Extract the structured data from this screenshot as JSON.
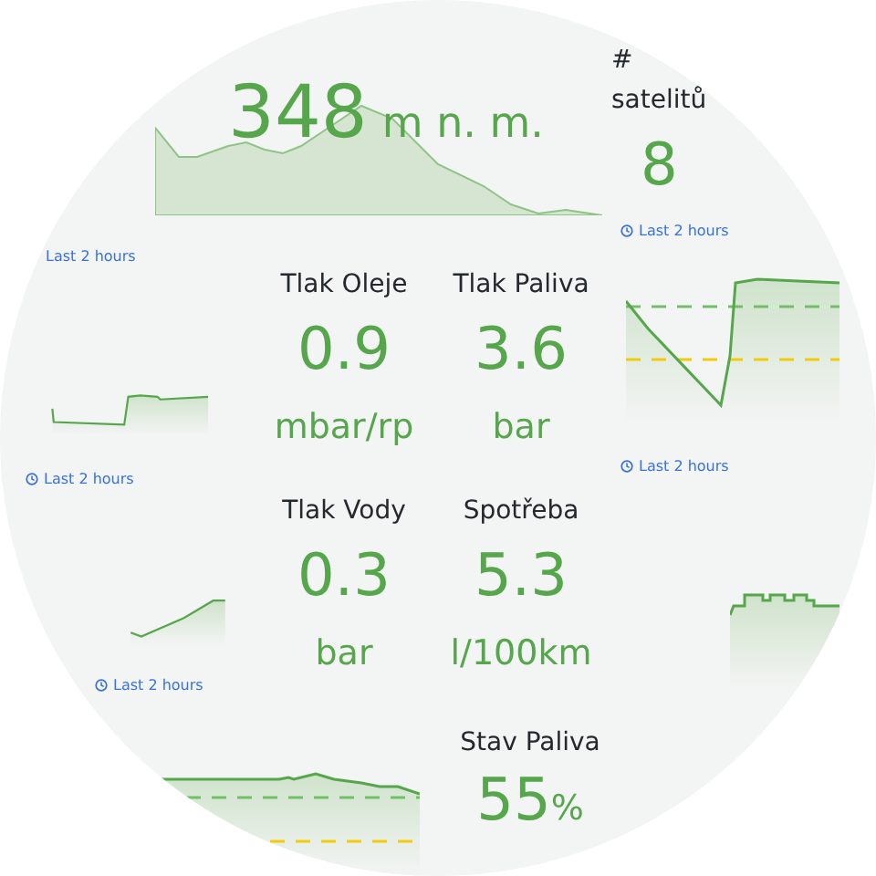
{
  "altitude": {
    "value": "348",
    "unit": "m n. m.",
    "time_range": "Last 2 hours"
  },
  "satellites": {
    "title": "# satelitů",
    "value": "8",
    "time_range": "Last 2 hours"
  },
  "left_panels": [
    {
      "time_range": "Last 2 hours"
    },
    {
      "time_range": "Last 2 hours"
    }
  ],
  "stats": [
    {
      "title": "Tlak Oleje",
      "value": "0.9",
      "unit": "mbar/rp"
    },
    {
      "title": "Tlak Paliva",
      "value": "3.6",
      "unit": "bar"
    },
    {
      "title": "Tlak Vody",
      "value": "0.3",
      "unit": "bar"
    },
    {
      "title": "Spotřeba",
      "value": "5.3",
      "unit": "l/100km"
    }
  ],
  "right_panels": [
    {
      "time_range": "Last 2 hours"
    }
  ],
  "fuel_level": {
    "title": "Stav Paliva",
    "value": "55",
    "unit": "%"
  }
}
